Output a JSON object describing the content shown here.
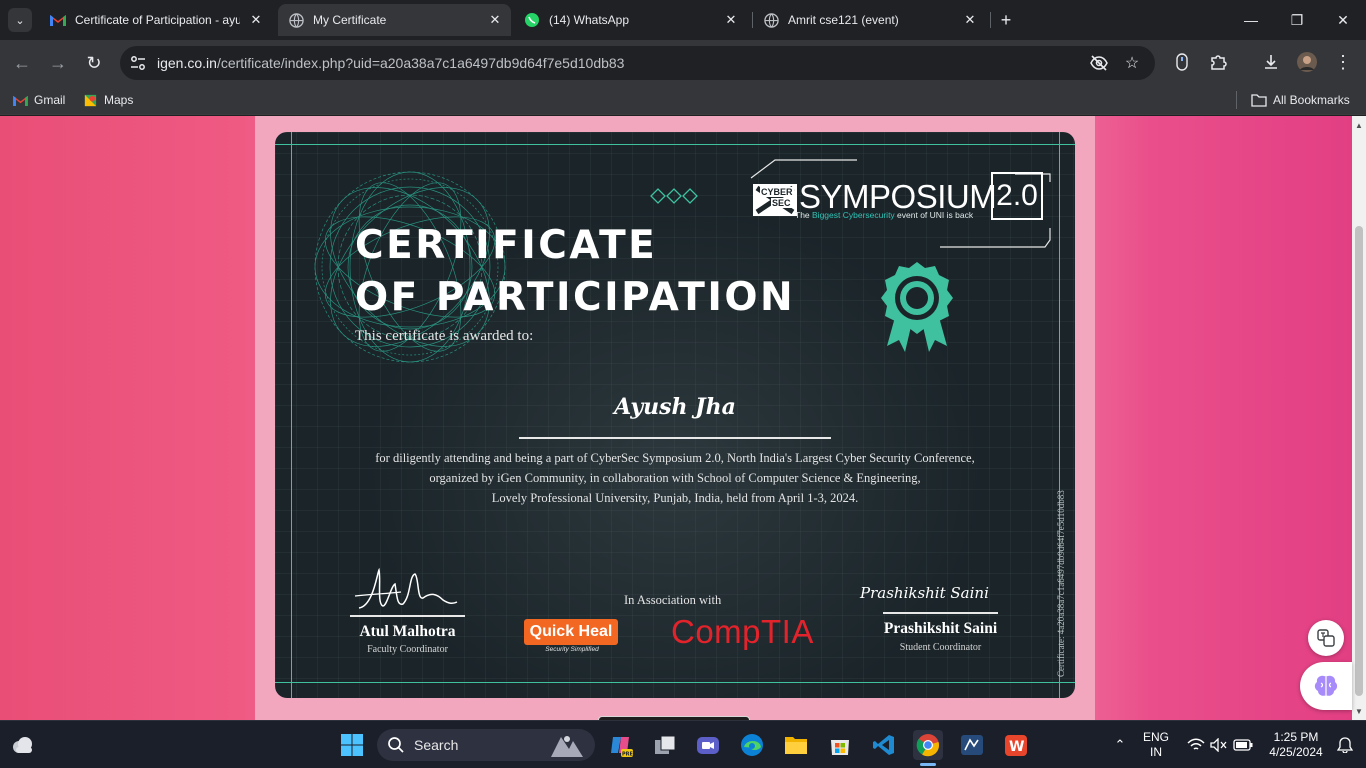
{
  "tabs": [
    {
      "title": "Certificate of Participation - ayu",
      "icon": "gmail-icon",
      "active": false
    },
    {
      "title": "My Certificate",
      "icon": "globe-icon",
      "active": true
    },
    {
      "title": "(14) WhatsApp",
      "icon": "whatsapp-icon",
      "active": false
    },
    {
      "title": "Amrit cse121 (event)",
      "icon": "globe-icon",
      "active": false
    }
  ],
  "toolbar": {
    "url_host": "igen.co.in",
    "url_path": "/certificate/index.php?uid=a20a38a7c1a6497db9d64f7e5d10db83"
  },
  "bookmarks": {
    "items": [
      {
        "label": "Gmail",
        "icon": "gmail-icon"
      },
      {
        "label": "Maps",
        "icon": "maps-icon"
      }
    ],
    "all_label": "All Bookmarks"
  },
  "certificate": {
    "title_line1": "CERTIFICATE",
    "title_line2": "OF PARTICIPATION",
    "awarded_to": "This certificate is awarded to:",
    "recipient": "Ayush Jha",
    "body_line1": "for diligently attending and being a part of CyberSec Symposium 2.0, North India's Largest Cyber Security Conference,",
    "body_line2": "organized by iGen Community, in collaboration with School of Computer Science & Engineering,",
    "body_line3": "Lovely Professional University, Punjab, India, held from April 1-3, 2024.",
    "event_logo": {
      "cyber": "CYBER",
      "sec": "SEC",
      "word": "SYMPOSIUM",
      "version": "2.0",
      "tagline_pre": "The ",
      "tagline_hl1": "Biggest Cybersecurity",
      "tagline_post": " event of UNI is back"
    },
    "signer_left": {
      "name": "Atul Malhotra",
      "role": "Faculty Coordinator"
    },
    "signer_right": {
      "name": "Prashikshit Saini",
      "role": "Student Coordinator",
      "signature": "Prashikshit Saini"
    },
    "association_label": "In Association with",
    "partner1": {
      "name": "Quick Heal",
      "tagline": "Security Simplified"
    },
    "partner2": {
      "name": "CompTIA"
    },
    "certificate_id": "Certificate: 4a20a38a7c1a6497db9d64f7e5d10db83",
    "accent_color": "#3fc1a0"
  },
  "taskbar": {
    "search_label": "Search",
    "lang_line1": "ENG",
    "lang_line2": "IN",
    "time": "1:25 PM",
    "date": "4/25/2024"
  }
}
